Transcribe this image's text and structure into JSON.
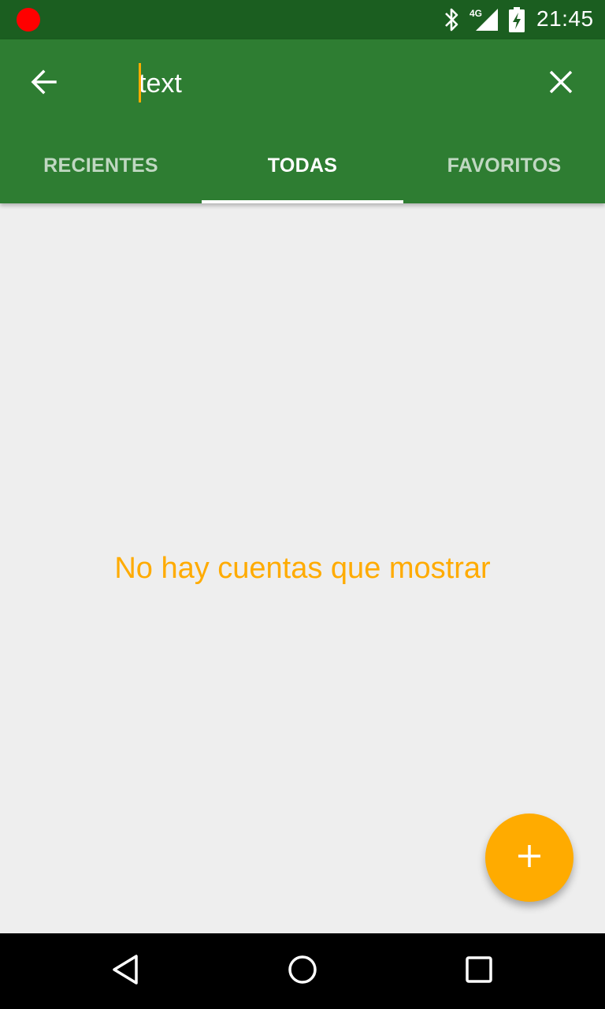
{
  "status_bar": {
    "time": "21:45",
    "network": "4G",
    "icons": [
      "recording-dot-icon",
      "bluetooth-icon",
      "signal-icon",
      "battery-charging-icon"
    ]
  },
  "app_bar": {
    "search_value": "text",
    "back_icon": "arrow-back-icon",
    "clear_icon": "close-icon"
  },
  "tabs": [
    {
      "label": "RECIENTES",
      "active": false
    },
    {
      "label": "TODAS",
      "active": true
    },
    {
      "label": "FAVORITOS",
      "active": false
    }
  ],
  "content": {
    "empty_message": "No hay cuentas que mostrar"
  },
  "fab": {
    "icon": "plus-icon"
  },
  "nav_bar": {
    "icons": [
      "nav-back-icon",
      "nav-home-icon",
      "nav-recents-icon"
    ]
  },
  "colors": {
    "status_bar": "#1b5e20",
    "app_bar": "#2e7d32",
    "accent": "#ffab00",
    "background": "#eeeeee"
  }
}
